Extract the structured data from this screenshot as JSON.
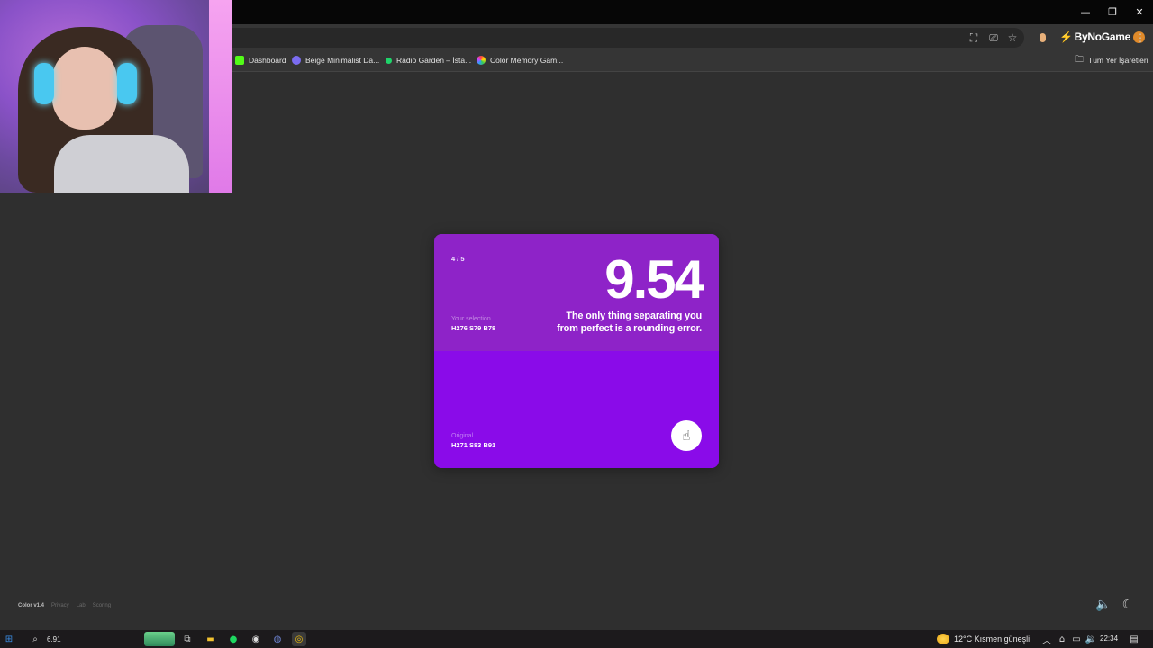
{
  "browser": {
    "window_controls": [
      "—",
      "❐",
      "✕"
    ],
    "extension_brand": "ByNoGame",
    "bookmarks": [
      {
        "label": "Dashboard",
        "color": "#53fc18"
      },
      {
        "label": "Beige Minimalist Da...",
        "color": "#7b6cf0"
      },
      {
        "label": "Radio Garden – İsta...",
        "color": "#1fd46a"
      },
      {
        "label": "Color Memory Gam...",
        "color": "#e85ad8"
      }
    ],
    "all_bookmarks_label": "Tüm Yer İşaretleri"
  },
  "game": {
    "round": "4 / 5",
    "score": "9.54",
    "message_line1": "The only thing separating you",
    "message_line2": "from perfect is a rounding error.",
    "selection_label": "Your selection",
    "selection_value": "H276 S79 B78",
    "original_label": "Original",
    "original_value": "H271 S83 B91",
    "selection_color": "#8e23c8",
    "original_color": "#8a0be9",
    "next_icon": "hand-pointer-icon"
  },
  "footer": {
    "brand": "Color v1.4",
    "links": [
      "Privacy",
      "Lab",
      "Scoring"
    ]
  },
  "taskbar": {
    "search_text": "6.91",
    "weather": "12°C  Kısmen güneşli",
    "clock": "22:34"
  }
}
